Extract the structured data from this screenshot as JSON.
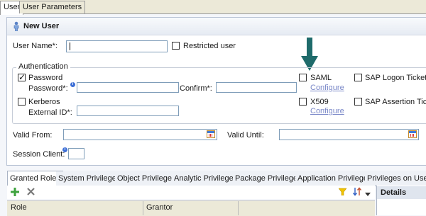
{
  "top_tabs": [
    "User",
    "User Parameters"
  ],
  "header": {
    "title": "New User",
    "icon": "person-icon"
  },
  "user_name": {
    "label": "User Name*:",
    "value": ""
  },
  "restricted_user_label": "Restricted user",
  "authentication": {
    "legend": "Authentication",
    "password": {
      "label": "Password",
      "checked": true,
      "password_label": "Password*:",
      "confirm_label": "Confirm*:"
    },
    "kerberos": {
      "label": "Kerberos",
      "checked": false,
      "external_id_label": "External ID*:"
    },
    "saml": {
      "label": "SAML",
      "checked": false,
      "configure": "Configure"
    },
    "x509": {
      "label": "X509",
      "checked": false,
      "configure": "Configure"
    },
    "sap_logon_ticket": {
      "label": "SAP Logon Ticket",
      "checked": false
    },
    "sap_assertion_ticket": {
      "label": "SAP Assertion Ticket",
      "checked": false
    }
  },
  "valid_from_label": "Valid From:",
  "valid_until_label": "Valid Until:",
  "session_client_label": "Session Client:",
  "bottom_tabs": [
    "Granted Roles",
    "System Privileges",
    "Object Privileges",
    "Analytic Privileges",
    "Package Privileges",
    "Application Privileges",
    "Privileges on Users"
  ],
  "table": {
    "columns": [
      "Role",
      "Grantor"
    ]
  },
  "details_title": "Details",
  "colors": {
    "arrow": "#1f6b6b",
    "link": "#7a88c8",
    "info": "#3d6fd6"
  }
}
